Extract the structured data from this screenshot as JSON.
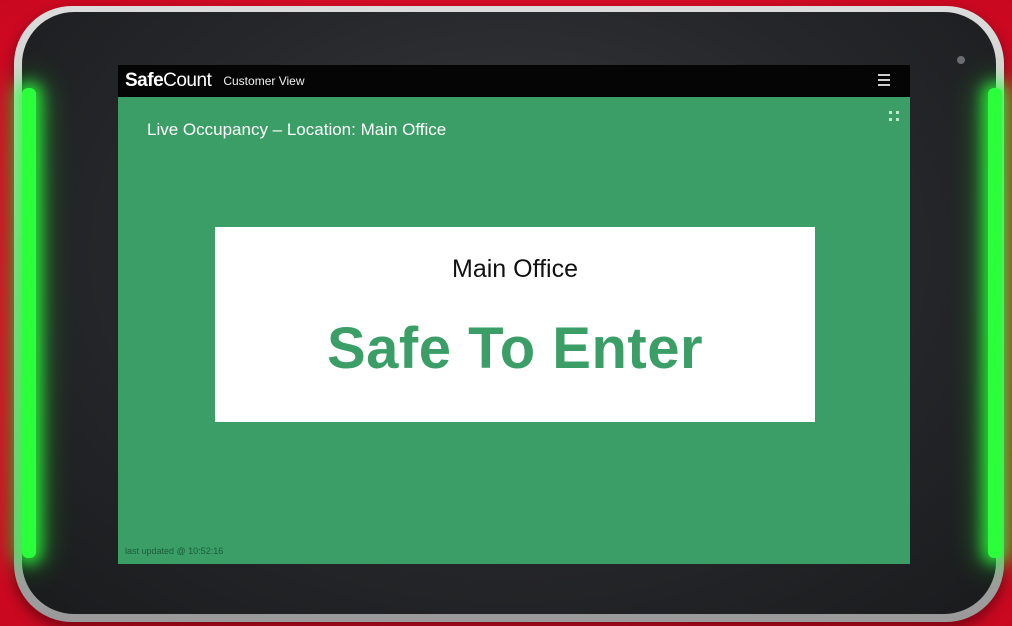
{
  "app": {
    "brand_bold": "Safe",
    "brand_light": "Count",
    "view_label": "Customer View"
  },
  "header": {
    "occupancy_heading": "Live Occupancy – Location: Main Office"
  },
  "status_card": {
    "location_name": "Main Office",
    "status_text": "Safe To Enter"
  },
  "footer": {
    "last_updated": "last updated @ 10:52:16"
  },
  "icons": {
    "menu": "hamburger-menu-icon",
    "fullscreen": "fullscreen-icon"
  },
  "colors": {
    "screen_background": "#3a9e66",
    "status_text": "#3a9e66",
    "topbar": "#050505",
    "side_glow": "#2bff3c",
    "page_background": "#e5102e"
  }
}
